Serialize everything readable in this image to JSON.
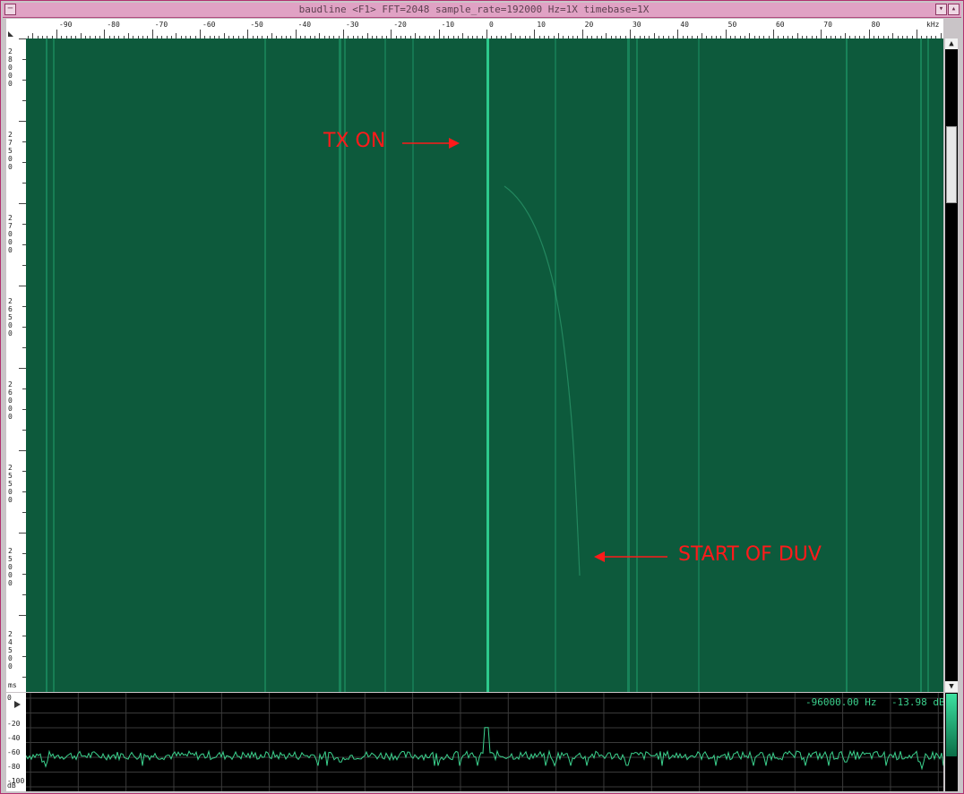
{
  "window": {
    "title": "baudline  <F1> FFT=2048 sample_rate=192000 Hz=1X timebase=1X",
    "menu_icon": "menu-icon",
    "min_icon": "minimize-icon",
    "max_icon": "maximize-icon"
  },
  "freq_ruler": {
    "labels": [
      "-90",
      "-80",
      "-70",
      "-60",
      "-50",
      "-40",
      "-30",
      "-20",
      "-10",
      "0",
      "10",
      "20",
      "30",
      "40",
      "50",
      "60",
      "70",
      "80"
    ],
    "values": [
      -90,
      -80,
      -70,
      -60,
      -50,
      -40,
      -30,
      -20,
      -10,
      0,
      10,
      20,
      30,
      40,
      50,
      60,
      70,
      80
    ],
    "unit": "kHz"
  },
  "time_ruler": {
    "labels": [
      "28000",
      "27500",
      "27000",
      "26500",
      "26000",
      "25500",
      "25000",
      "24500"
    ],
    "unit": "ms"
  },
  "annotations": {
    "tx_on": "TX ON",
    "start_duv": "START OF DUV"
  },
  "spectrum": {
    "db_labels": [
      "0",
      "-20",
      "-40",
      "-60",
      "-80",
      "-100"
    ],
    "db_unit": "dB",
    "freq_readout": "-96000.00 Hz",
    "db_readout": "-13.98 dB"
  },
  "colors": {
    "waterfall": "#0d5a3c",
    "signal": "#2fd090",
    "annotation": "#ff1a1a",
    "trace": "#3bd18d"
  }
}
